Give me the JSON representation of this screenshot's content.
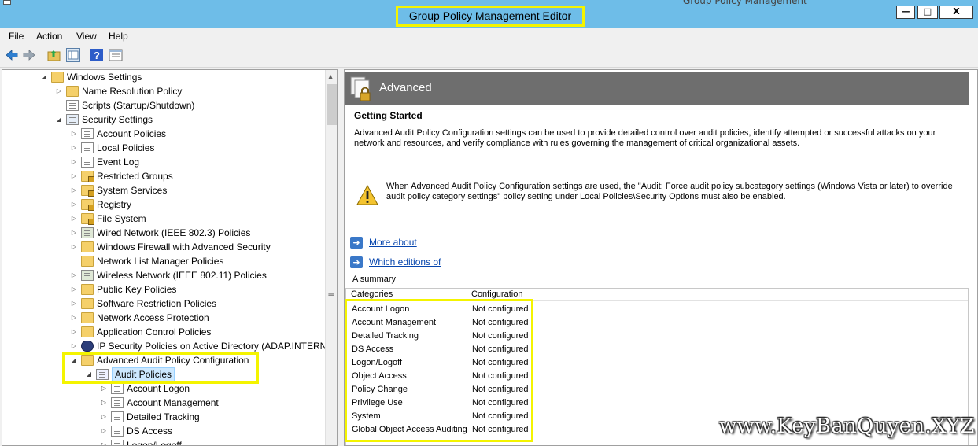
{
  "window": {
    "title": "Group Policy Management Editor",
    "background_title": "Group Policy Management",
    "buttons": {
      "minimize": "—",
      "maximize": "□",
      "close": "X"
    }
  },
  "menu": [
    "File",
    "Action",
    "View",
    "Help"
  ],
  "toolbar": {
    "icons": [
      "back-arrow-icon",
      "forward-arrow-icon",
      "up-folder-icon",
      "show-hide-tree-icon",
      "help-icon",
      "properties-icon"
    ]
  },
  "tree": [
    {
      "label": "Windows Settings",
      "expander": "◢",
      "icon": "folder"
    },
    {
      "label": "Name Resolution Policy",
      "expander": "▷",
      "icon": "folder"
    },
    {
      "label": "Scripts (Startup/Shutdown)",
      "expander": "",
      "icon": "scripts"
    },
    {
      "label": "Security Settings",
      "expander": "◢",
      "icon": "security"
    },
    {
      "label": "Account Policies",
      "expander": "▷",
      "icon": "policy"
    },
    {
      "label": "Local Policies",
      "expander": "▷",
      "icon": "policy"
    },
    {
      "label": "Event Log",
      "expander": "▷",
      "icon": "policy"
    },
    {
      "label": "Restricted Groups",
      "expander": "▷",
      "icon": "lockfolder"
    },
    {
      "label": "System Services",
      "expander": "▷",
      "icon": "lockfolder"
    },
    {
      "label": "Registry",
      "expander": "▷",
      "icon": "lockfolder"
    },
    {
      "label": "File System",
      "expander": "▷",
      "icon": "lockfolder"
    },
    {
      "label": "Wired Network (IEEE 802.3) Policies",
      "expander": "▷",
      "icon": "network"
    },
    {
      "label": "Windows Firewall with Advanced Security",
      "expander": "▷",
      "icon": "folder"
    },
    {
      "label": "Network List Manager Policies",
      "expander": "",
      "icon": "folder"
    },
    {
      "label": "Wireless Network (IEEE 802.11) Policies",
      "expander": "▷",
      "icon": "network"
    },
    {
      "label": "Public Key Policies",
      "expander": "▷",
      "icon": "folder"
    },
    {
      "label": "Software Restriction Policies",
      "expander": "▷",
      "icon": "folder"
    },
    {
      "label": "Network Access Protection",
      "expander": "▷",
      "icon": "folder"
    },
    {
      "label": "Application Control Policies",
      "expander": "▷",
      "icon": "folder"
    },
    {
      "label": "IP Security Policies on Active Directory (ADAP.INTERNA",
      "expander": "▷",
      "icon": "ipsec"
    },
    {
      "label": "Advanced Audit Policy Configuration",
      "expander": "◢",
      "icon": "folder"
    },
    {
      "label": "Audit Policies",
      "expander": "◢",
      "icon": "audit",
      "selected": true
    },
    {
      "label": "Account Logon",
      "expander": "▷",
      "icon": "policy"
    },
    {
      "label": "Account Management",
      "expander": "▷",
      "icon": "policy"
    },
    {
      "label": "Detailed Tracking",
      "expander": "▷",
      "icon": "policy"
    },
    {
      "label": "DS Access",
      "expander": "▷",
      "icon": "policy"
    },
    {
      "label": "Logon/Logoff",
      "expander": "▷",
      "icon": "policy"
    }
  ],
  "detail": {
    "banner_title": "Advanced",
    "heading": "Getting Started",
    "intro": "Advanced Audit Policy Configuration settings can be used to provide detailed control over audit policies, identify attempted or successful attacks on your network and resources, and verify compliance with rules governing the management of critical organizational assets.",
    "warning": "When Advanced Audit Policy Configuration settings are used, the \"Audit: Force audit policy subcategory settings (Windows Vista or later) to override audit policy category settings\" policy setting under Local Policies\\Security Options must also be enabled.",
    "links": [
      "More about",
      "Which editions of"
    ],
    "summary_label": "A summary",
    "columns": [
      "Categories",
      "Configuration"
    ],
    "rows": [
      {
        "category": "Account Logon",
        "config": "Not configured"
      },
      {
        "category": "Account Management",
        "config": "Not configured"
      },
      {
        "category": "Detailed Tracking",
        "config": "Not configured"
      },
      {
        "category": "DS Access",
        "config": "Not configured"
      },
      {
        "category": "Logon/Logoff",
        "config": "Not configured"
      },
      {
        "category": "Object Access",
        "config": "Not configured"
      },
      {
        "category": "Policy Change",
        "config": "Not configured"
      },
      {
        "category": "Privilege Use",
        "config": "Not configured"
      },
      {
        "category": "System",
        "config": "Not configured"
      },
      {
        "category": "Global Object Access Auditing",
        "config": "Not configured"
      }
    ]
  },
  "watermark": "www.KeyBanQuyen.XYZ",
  "colors": {
    "titlebar": "#6ebde8",
    "highlight": "#f4f400",
    "banner": "#6e6e6e",
    "link": "#0645ad"
  }
}
